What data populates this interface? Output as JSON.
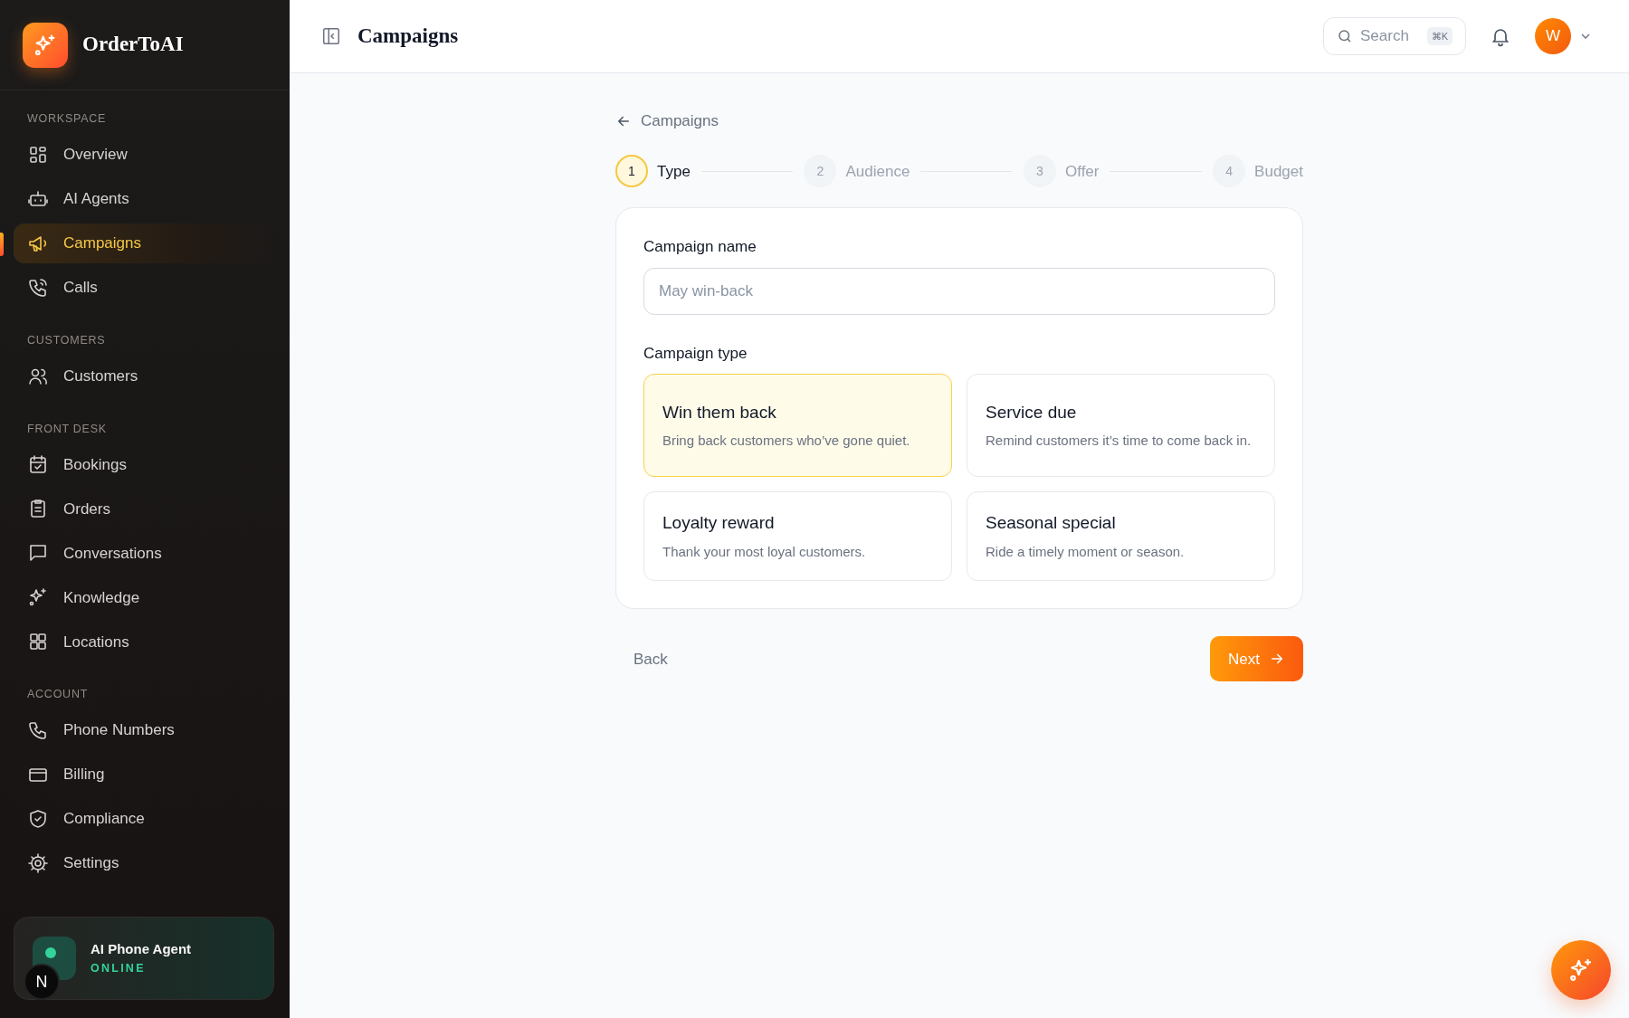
{
  "brand": {
    "name": "OrderToAI"
  },
  "sidebar": {
    "sections": [
      {
        "title": "WORKSPACE",
        "items": [
          {
            "label": "Overview",
            "selected": false
          },
          {
            "label": "AI Agents",
            "selected": false
          },
          {
            "label": "Campaigns",
            "selected": true
          },
          {
            "label": "Calls",
            "selected": false
          }
        ]
      },
      {
        "title": "CUSTOMERS",
        "items": [
          {
            "label": "Customers",
            "selected": false
          }
        ]
      },
      {
        "title": "FRONT DESK",
        "items": [
          {
            "label": "Bookings",
            "selected": false
          },
          {
            "label": "Orders",
            "selected": false
          },
          {
            "label": "Conversations",
            "selected": false
          },
          {
            "label": "Knowledge",
            "selected": false
          },
          {
            "label": "Locations",
            "selected": false
          }
        ]
      },
      {
        "title": "ACCOUNT",
        "items": [
          {
            "label": "Phone Numbers",
            "selected": false
          },
          {
            "label": "Billing",
            "selected": false
          },
          {
            "label": "Compliance",
            "selected": false
          },
          {
            "label": "Settings",
            "selected": false
          }
        ]
      }
    ],
    "agent_card": {
      "title": "AI Phone Agent",
      "status": "ONLINE",
      "online": true
    },
    "dev_badge": "N"
  },
  "header": {
    "title": "Campaigns",
    "search": {
      "placeholder": "Search",
      "shortcut": "⌘K"
    },
    "avatar": "W"
  },
  "breadcrumb": "Campaigns",
  "steps": [
    {
      "number": "1",
      "label": "Type",
      "selected": true
    },
    {
      "number": "2",
      "label": "Audience",
      "selected": false
    },
    {
      "number": "3",
      "label": "Offer",
      "selected": false
    },
    {
      "number": "4",
      "label": "Budget",
      "selected": false
    }
  ],
  "form": {
    "name_label": "Campaign name",
    "name_placeholder": "May win-back",
    "type_label": "Campaign type",
    "types": [
      {
        "title": "Win them back",
        "description": "Bring back customers who’ve gone quiet.",
        "selected": true
      },
      {
        "title": "Service due",
        "description": "Remind customers it’s time to come back in.",
        "selected": false
      },
      {
        "title": "Loyalty reward",
        "description": "Thank your most loyal customers.",
        "selected": false
      },
      {
        "title": "Seasonal special",
        "description": "Ride a timely moment or season.",
        "selected": false
      }
    ]
  },
  "actions": {
    "back": "Back",
    "next": "Next"
  }
}
